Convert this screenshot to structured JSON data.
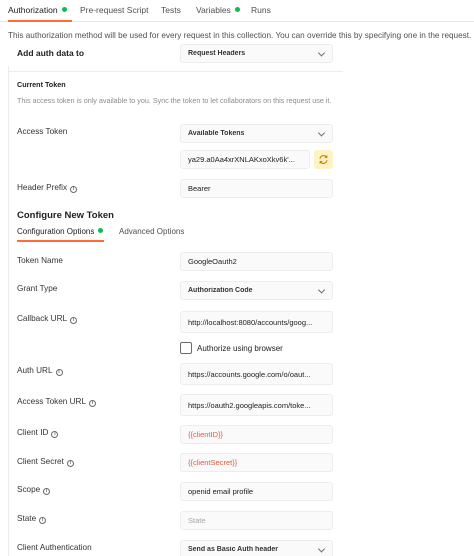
{
  "tabs": [
    {
      "label": "Authorization",
      "active": true,
      "dot": true
    },
    {
      "label": "Pre-request Script",
      "active": false,
      "dot": false
    },
    {
      "label": "Tests",
      "active": false,
      "dot": false
    },
    {
      "label": "Variables",
      "active": false,
      "dot": true
    },
    {
      "label": "Runs",
      "active": false,
      "dot": false
    }
  ],
  "info_text": "This authorization method will be used for every request in this collection. You can override this by specifying one in the request.",
  "auth_data": {
    "label": "Add auth data to",
    "value": "Request Headers"
  },
  "current_token": {
    "title": "Current Token",
    "note": "This access token is only available to you. Sync the token to let collaborators on this request use it.",
    "access_token_label": "Access Token",
    "available_tokens": "Available Tokens",
    "token_value": "ya29.a0Aa4xrXNLAKxoXkv6k'...",
    "header_prefix_label": "Header Prefix",
    "header_prefix_value": "Bearer"
  },
  "configure": {
    "title": "Configure New Token",
    "subtabs": [
      "Configuration Options",
      "Advanced Options"
    ],
    "fields": {
      "token_name": {
        "label": "Token Name",
        "value": "GoogleOauth2"
      },
      "grant_type": {
        "label": "Grant Type",
        "value": "Authorization Code"
      },
      "callback_url": {
        "label": "Callback URL",
        "value": "http://localhost:8080/accounts/goog..."
      },
      "authorize_browser": "Authorize using browser",
      "auth_url": {
        "label": "Auth URL",
        "value": "https://accounts.google.com/o/oaut..."
      },
      "access_token_url": {
        "label": "Access Token URL",
        "value": "https://oauth2.googleapis.com/toke..."
      },
      "client_id": {
        "label": "Client ID",
        "value": "{{clientID}}"
      },
      "client_secret": {
        "label": "Client Secret",
        "value": "{{clientSecret}}"
      },
      "scope": {
        "label": "Scope",
        "value": "openid email profile"
      },
      "state": {
        "label": "State",
        "placeholder": "State"
      },
      "client_auth": {
        "label": "Client Authentication",
        "value": "Send as Basic Auth header"
      }
    }
  },
  "colors": {
    "accent": "#ff6c37",
    "status_dot": "#0cbb52",
    "variable": "#e8553b"
  }
}
